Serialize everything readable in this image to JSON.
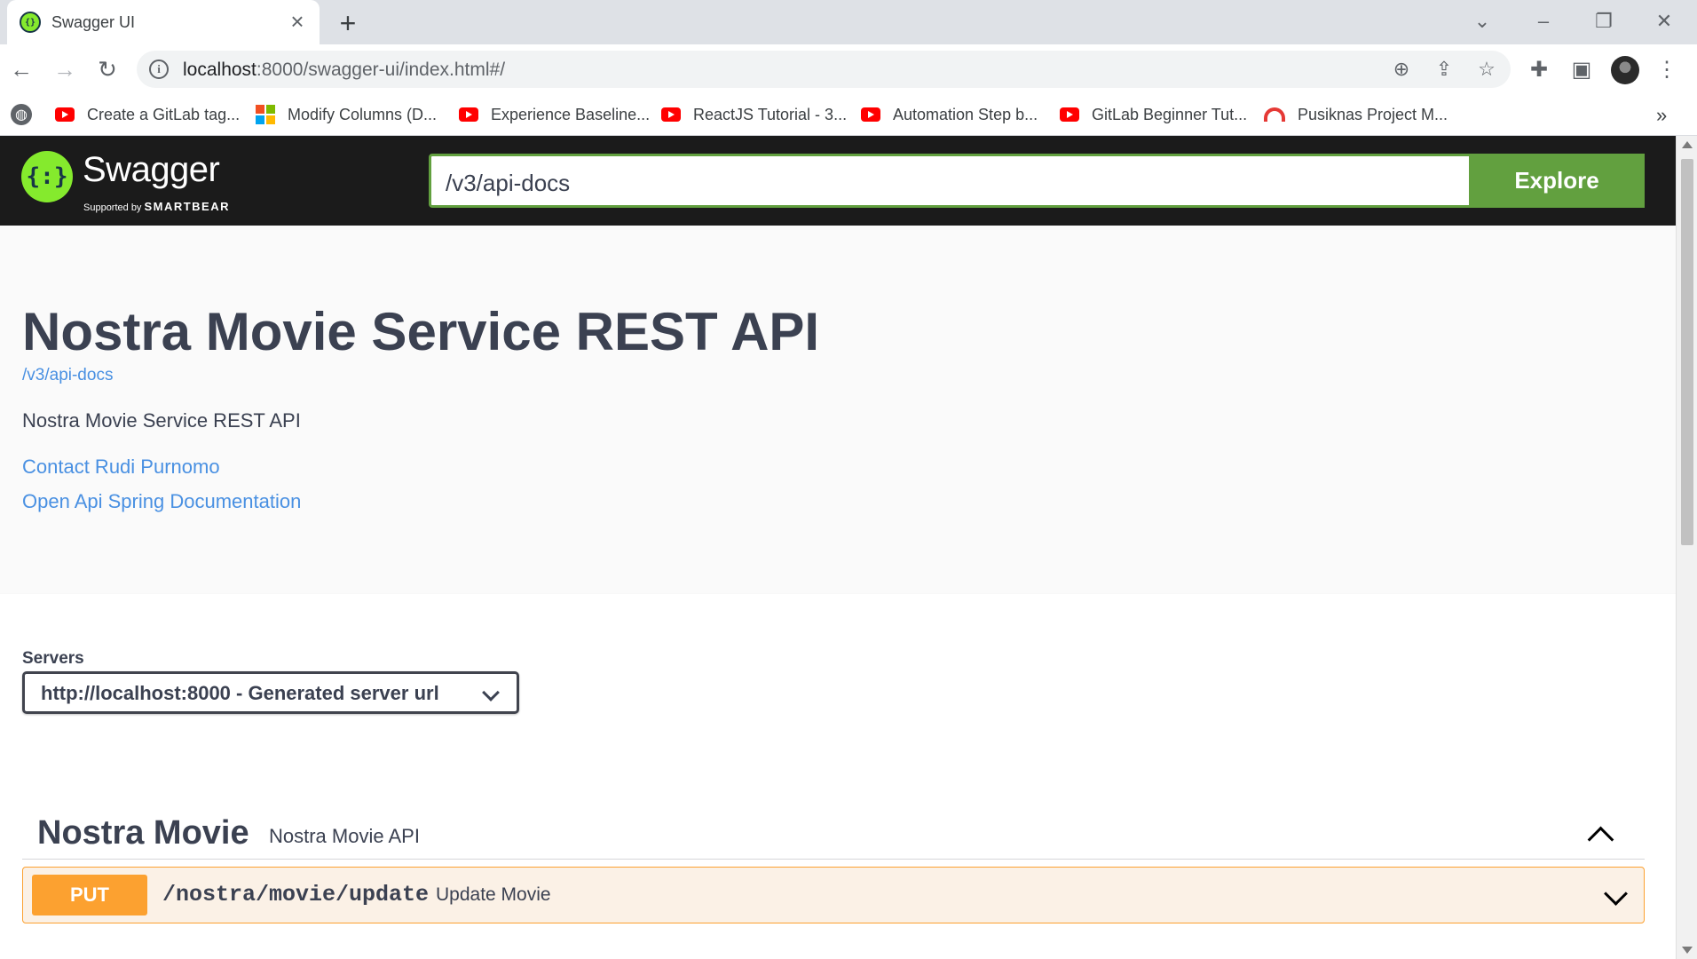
{
  "browser": {
    "tab_title": "Swagger UI",
    "tab_close": "×",
    "new_tab": "+",
    "url_host": "localhost",
    "url_rest": ":8000/swagger-ui/index.html#/",
    "bookmarks": [
      "Create a GitLab tag...",
      "Modify Columns (D...",
      "Experience Baseline...",
      "ReactJS Tutorial - 3...",
      "Automation Step b...",
      "GitLab Beginner Tut...",
      "Pusiknas Project M..."
    ],
    "bookmarks_more": "»"
  },
  "swagger": {
    "logo_text": "Swagger",
    "logo_sub_prefix": "Supported by",
    "logo_sub_brand": "SMARTBEAR",
    "search_value": "/v3/api-docs",
    "explore_label": "Explore"
  },
  "info": {
    "title": "Nostra Movie Service REST API",
    "url": "/v3/api-docs",
    "description": "Nostra Movie Service REST API",
    "contact_link": "Contact Rudi Purnomo",
    "docs_link": "Open Api Spring Documentation"
  },
  "servers": {
    "label": "Servers",
    "selected": "http://localhost:8000 - Generated server url"
  },
  "tag": {
    "name": "Nostra Movie",
    "description": "Nostra Movie API"
  },
  "operation": {
    "method": "PUT",
    "path": "/nostra/movie/update",
    "summary": "Update Movie"
  },
  "colors": {
    "swagger_green": "#62a03f",
    "put_orange": "#fca130",
    "link_blue": "#4990e2",
    "text_dark": "#3b4151"
  }
}
